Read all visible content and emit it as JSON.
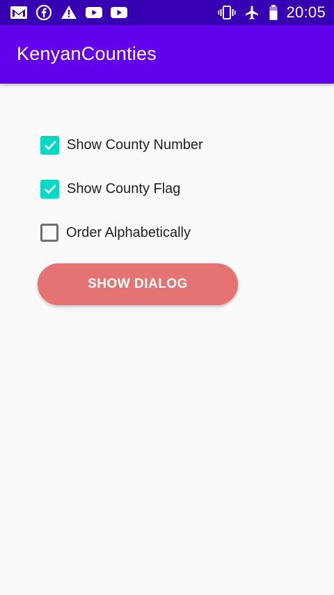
{
  "status_bar": {
    "left_icons": [
      "gmail-icon",
      "facebook-icon",
      "warning-icon",
      "youtube-icon",
      "youtube-icon"
    ],
    "right_icons": [
      "vibrate-icon",
      "airplane-mode-icon",
      "battery-icon"
    ],
    "time": "20:05"
  },
  "app_bar": {
    "title": "KenyanCounties"
  },
  "options": [
    {
      "label": "Show County Number",
      "checked": true
    },
    {
      "label": "Show County Flag",
      "checked": true
    },
    {
      "label": "Order Alphabetically",
      "checked": false
    }
  ],
  "dialog_button": {
    "label": "SHOW DIALOG"
  },
  "colors": {
    "status_bar": "#3700b3",
    "app_bar": "#6200ee",
    "checkbox_accent": "#03dac5",
    "button": "#e57373",
    "background": "#fafafa"
  }
}
